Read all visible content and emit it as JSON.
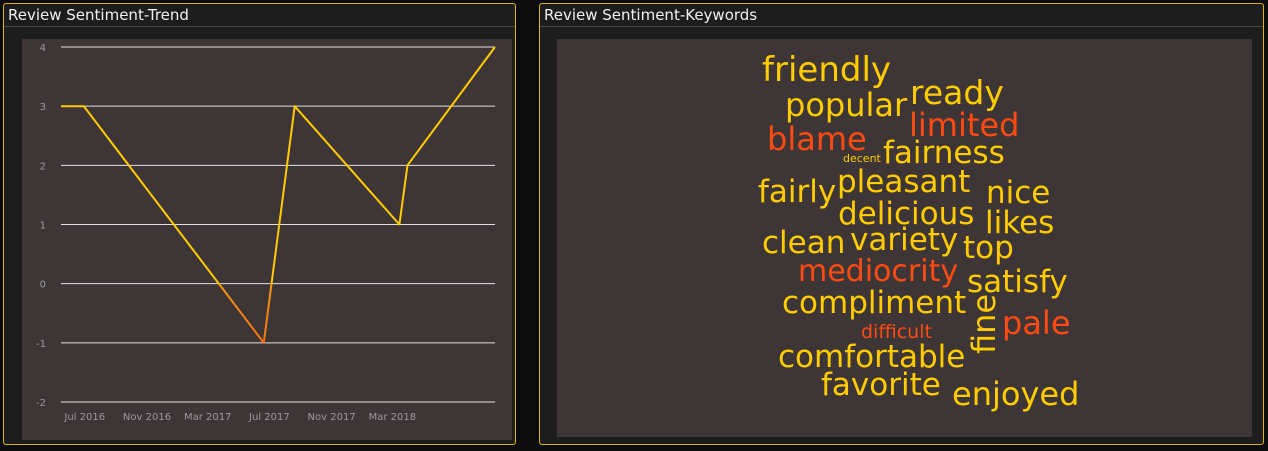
{
  "panels": {
    "trend_title": "Review Sentiment-Trend",
    "keywords_title": "Review Sentiment-Keywords"
  },
  "colors": {
    "positive": "#ffcc00",
    "negative": "#ff4a12",
    "line_mid": "#f39a0a",
    "grid": "#ffffff",
    "tick_text": "#9a9a9a",
    "panel_border": "#d9b800",
    "plot_bg": "#3e3636"
  },
  "chart_data": [
    {
      "type": "line",
      "title": "Review Sentiment-Trend",
      "xlabel": "",
      "ylabel": "",
      "ylim": [
        -2,
        4
      ],
      "y_ticks": [
        4,
        3,
        2,
        1,
        0,
        -1,
        -2
      ],
      "y_tick_labels": [
        "4",
        "3",
        "2",
        "1",
        "0",
        "-1",
        "-2"
      ],
      "x_tick_labels": [
        "Jul 2016",
        "Nov 2016",
        "Mar 2017",
        "Jul 2017",
        "Nov 2017",
        "Mar 2018"
      ],
      "x_tick_dates": [
        "2016-07-01",
        "2016-11-01",
        "2017-03-01",
        "2017-07-01",
        "2017-11-01",
        "2018-03-01"
      ],
      "xlim": [
        "2016-05-15",
        "2018-09-20"
      ],
      "grid": true,
      "series": [
        {
          "x": [
            "2016-05-15",
            "2016-06-29",
            "2017-06-20",
            "2017-08-20",
            "2018-03-15",
            "2018-03-31",
            "2018-09-20"
          ],
          "y": [
            3,
            3,
            -1,
            3,
            1,
            2,
            4
          ]
        }
      ]
    },
    {
      "type": "wordcloud",
      "title": "Review Sentiment-Keywords",
      "words": [
        {
          "text": "friendly",
          "sentiment": "positive"
        },
        {
          "text": "ready",
          "sentiment": "positive"
        },
        {
          "text": "popular",
          "sentiment": "positive"
        },
        {
          "text": "limited",
          "sentiment": "negative"
        },
        {
          "text": "blame",
          "sentiment": "negative"
        },
        {
          "text": "decent",
          "sentiment": "positive"
        },
        {
          "text": "fairness",
          "sentiment": "positive"
        },
        {
          "text": "pleasant",
          "sentiment": "positive"
        },
        {
          "text": "fairly",
          "sentiment": "positive"
        },
        {
          "text": "nice",
          "sentiment": "positive"
        },
        {
          "text": "delicious",
          "sentiment": "positive"
        },
        {
          "text": "likes",
          "sentiment": "positive"
        },
        {
          "text": "clean",
          "sentiment": "positive"
        },
        {
          "text": "variety",
          "sentiment": "positive"
        },
        {
          "text": "top",
          "sentiment": "positive"
        },
        {
          "text": "mediocrity",
          "sentiment": "negative"
        },
        {
          "text": "satisfy",
          "sentiment": "positive"
        },
        {
          "text": "compliment",
          "sentiment": "positive"
        },
        {
          "text": "pale",
          "sentiment": "negative"
        },
        {
          "text": "difficult",
          "sentiment": "negative"
        },
        {
          "text": "fine",
          "sentiment": "positive"
        },
        {
          "text": "comfortable",
          "sentiment": "positive"
        },
        {
          "text": "favorite",
          "sentiment": "positive"
        },
        {
          "text": "enjoyed",
          "sentiment": "positive"
        }
      ]
    }
  ]
}
